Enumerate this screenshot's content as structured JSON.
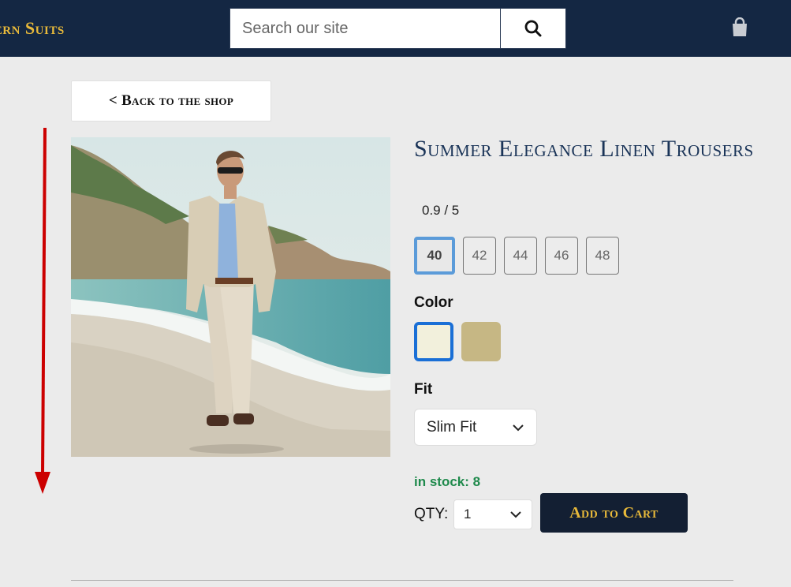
{
  "header": {
    "brand": "Modern Suits",
    "search_placeholder": "Search our site",
    "search_icon": "search-icon",
    "cart_icon": "shopping-bag-icon"
  },
  "nav": {
    "back_label": "< Back to the shop"
  },
  "product": {
    "title": "Summer Elegance Linen Trousers",
    "rating": "0.9 / 5",
    "sizes": [
      "40",
      "42",
      "44",
      "46",
      "48"
    ],
    "selected_size": "40",
    "color_label": "Color",
    "colors": [
      "#f2f0dc",
      "#c6b784"
    ],
    "selected_color": 0,
    "fit_label": "Fit",
    "fit_value": "Slim Fit",
    "stock_text": "in stock: 8",
    "qty_label": "QTY:",
    "qty_value": "1",
    "add_to_cart": "Add to Cart"
  },
  "colors": {
    "header_bg": "#142743",
    "brand_gold": "#e8b93a",
    "title_blue": "#1a3458",
    "stock_green": "#1f8a4c",
    "annotation_red": "#cc0000"
  }
}
